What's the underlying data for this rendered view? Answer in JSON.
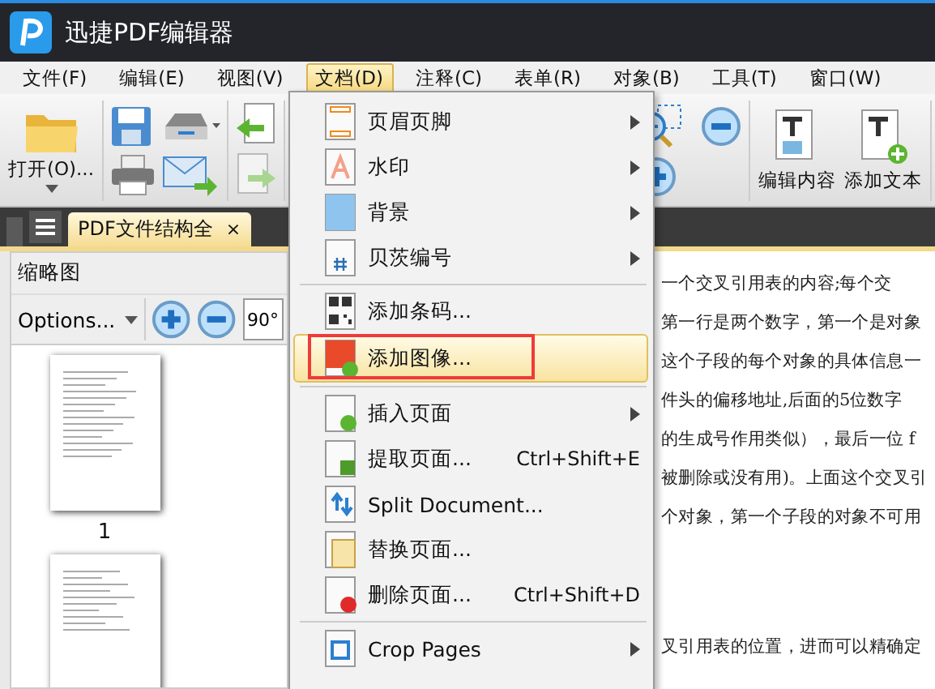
{
  "window": {
    "title": "迅捷PDF编辑器"
  },
  "menu_bar": [
    {
      "label": "文件(F)",
      "selected": false
    },
    {
      "label": "编辑(E)",
      "selected": false
    },
    {
      "label": "视图(V)",
      "selected": false
    },
    {
      "label": "文档(D)",
      "selected": true
    },
    {
      "label": "注释(C)",
      "selected": false
    },
    {
      "label": "表单(R)",
      "selected": false
    },
    {
      "label": "对象(B)",
      "selected": false
    },
    {
      "label": "工具(T)",
      "selected": false
    },
    {
      "label": "窗口(W)",
      "selected": false
    }
  ],
  "toolbar": {
    "open_button": "打开(O)...",
    "right_buttons": [
      "编辑内容",
      "添加文本"
    ]
  },
  "tabs": [
    {
      "label": "PDF文件结构全",
      "selected": true,
      "close": "×"
    }
  ],
  "thumbnail_panel": {
    "title": "缩略图",
    "options": "Options...",
    "rotate": "90°",
    "pages": [
      "1"
    ]
  },
  "document_lines": [
    "一个交叉引用表的内容;每个交",
    "第一行是两个数字，第一个是对象",
    "这个子段的每个对象的具体信息一",
    "件头的偏移地址,后面的5位数字",
    "的生成号作用类似），最后一位 f",
    "被删除或没有用)。上面这个交叉引",
    "个对象，第一个子段的对象不可用",
    "叉引用表的位置，进而可以精确定"
  ],
  "document_menu": {
    "groups": [
      [
        {
          "label": "页眉页脚",
          "submenu": true,
          "selected": false
        },
        {
          "label": "水印",
          "submenu": true,
          "selected": false
        },
        {
          "label": "背景",
          "submenu": true,
          "selected": false
        },
        {
          "label": "贝茨编号",
          "submenu": true,
          "selected": false
        }
      ],
      [
        {
          "label": "添加条码...",
          "submenu": false,
          "selected": false
        },
        {
          "label": "添加图像...",
          "submenu": false,
          "selected": true,
          "highlighted": true
        }
      ],
      [
        {
          "label": "插入页面",
          "submenu": true,
          "selected": false
        },
        {
          "label": "提取页面...",
          "submenu": false,
          "selected": false,
          "shortcut": "Ctrl+Shift+E"
        },
        {
          "label": "Split Document...",
          "submenu": false,
          "selected": false
        },
        {
          "label": "替换页面...",
          "submenu": false,
          "selected": false
        },
        {
          "label": "删除页面...",
          "submenu": false,
          "selected": false,
          "shortcut": "Ctrl+Shift+D"
        }
      ],
      [
        {
          "label": "Crop Pages",
          "submenu": true,
          "selected": false
        }
      ]
    ]
  }
}
